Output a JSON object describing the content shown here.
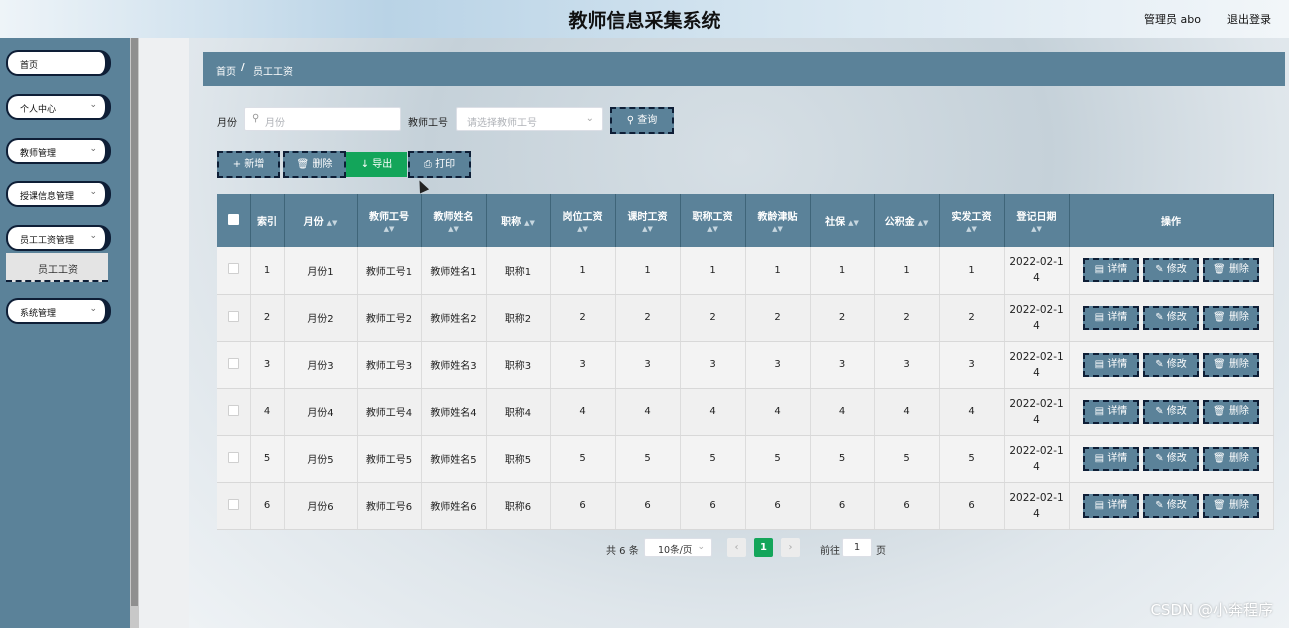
{
  "header": {
    "title": "教师信息采集系统",
    "user": "管理员 abo",
    "logout": "退出登录"
  },
  "sidebar": {
    "items": [
      {
        "label": "首页",
        "chevron": ""
      },
      {
        "label": "个人中心",
        "chevron": "⌄"
      },
      {
        "label": "教师管理",
        "chevron": "⌄"
      },
      {
        "label": "授课信息管理",
        "chevron": "⌄"
      },
      {
        "label": "员工工资管理",
        "chevron": "⌄"
      },
      {
        "label": "系统管理",
        "chevron": "⌄"
      }
    ],
    "sub_item": "员工工资"
  },
  "breadcrumb": {
    "home": "首页",
    "sep": "/",
    "current": "员工工资"
  },
  "search": {
    "month_label": "月份",
    "month_placeholder": "月份",
    "teacher_label": "教师工号",
    "teacher_placeholder": "请选择教师工号",
    "query_button": "查询"
  },
  "toolbar": {
    "add": "新增",
    "delete": "删除",
    "export": "导出",
    "print": "打印"
  },
  "table": {
    "headers": [
      "索引",
      "月份",
      "教师工号",
      "教师姓名",
      "职称",
      "岗位工资",
      "课时工资",
      "职称工资",
      "教龄津贴",
      "社保",
      "公积金",
      "实发工资",
      "登记日期",
      "操作"
    ],
    "rows": [
      [
        "1",
        "月份1",
        "教师工号1",
        "教师姓名1",
        "职称1",
        "1",
        "1",
        "1",
        "1",
        "1",
        "1",
        "1",
        "2022-02-1",
        "4"
      ],
      [
        "2",
        "月份2",
        "教师工号2",
        "教师姓名2",
        "职称2",
        "2",
        "2",
        "2",
        "2",
        "2",
        "2",
        "2",
        "2022-02-1",
        "4"
      ],
      [
        "3",
        "月份3",
        "教师工号3",
        "教师姓名3",
        "职称3",
        "3",
        "3",
        "3",
        "3",
        "3",
        "3",
        "3",
        "2022-02-1",
        "4"
      ],
      [
        "4",
        "月份4",
        "教师工号4",
        "教师姓名4",
        "职称4",
        "4",
        "4",
        "4",
        "4",
        "4",
        "4",
        "4",
        "2022-02-1",
        "4"
      ],
      [
        "5",
        "月份5",
        "教师工号5",
        "教师姓名5",
        "职称5",
        "5",
        "5",
        "5",
        "5",
        "5",
        "5",
        "5",
        "2022-02-1",
        "4"
      ],
      [
        "6",
        "月份6",
        "教师工号6",
        "教师姓名6",
        "职称6",
        "6",
        "6",
        "6",
        "6",
        "6",
        "6",
        "6",
        "2022-02-1",
        "4"
      ]
    ],
    "actions": {
      "detail": "详情",
      "edit": "修改",
      "delete": "删除"
    }
  },
  "pagination": {
    "total": "共 6 条",
    "page_size": "10条/页",
    "current_page": "1",
    "goto_label": "前往",
    "goto_value": "1",
    "page_unit": "页"
  },
  "icons": {
    "search": "⚲",
    "plus": "+",
    "trash": "🗑",
    "download": "↓",
    "print": "⎙",
    "detail": "▤",
    "edit": "✎",
    "chevron_down": "⌄",
    "prev": "‹",
    "next": "›"
  },
  "colors": {
    "accent": "#5b8299",
    "green": "#13a55a",
    "border_dark": "#0e1e36"
  },
  "watermark": "CSDN @小奔程序"
}
